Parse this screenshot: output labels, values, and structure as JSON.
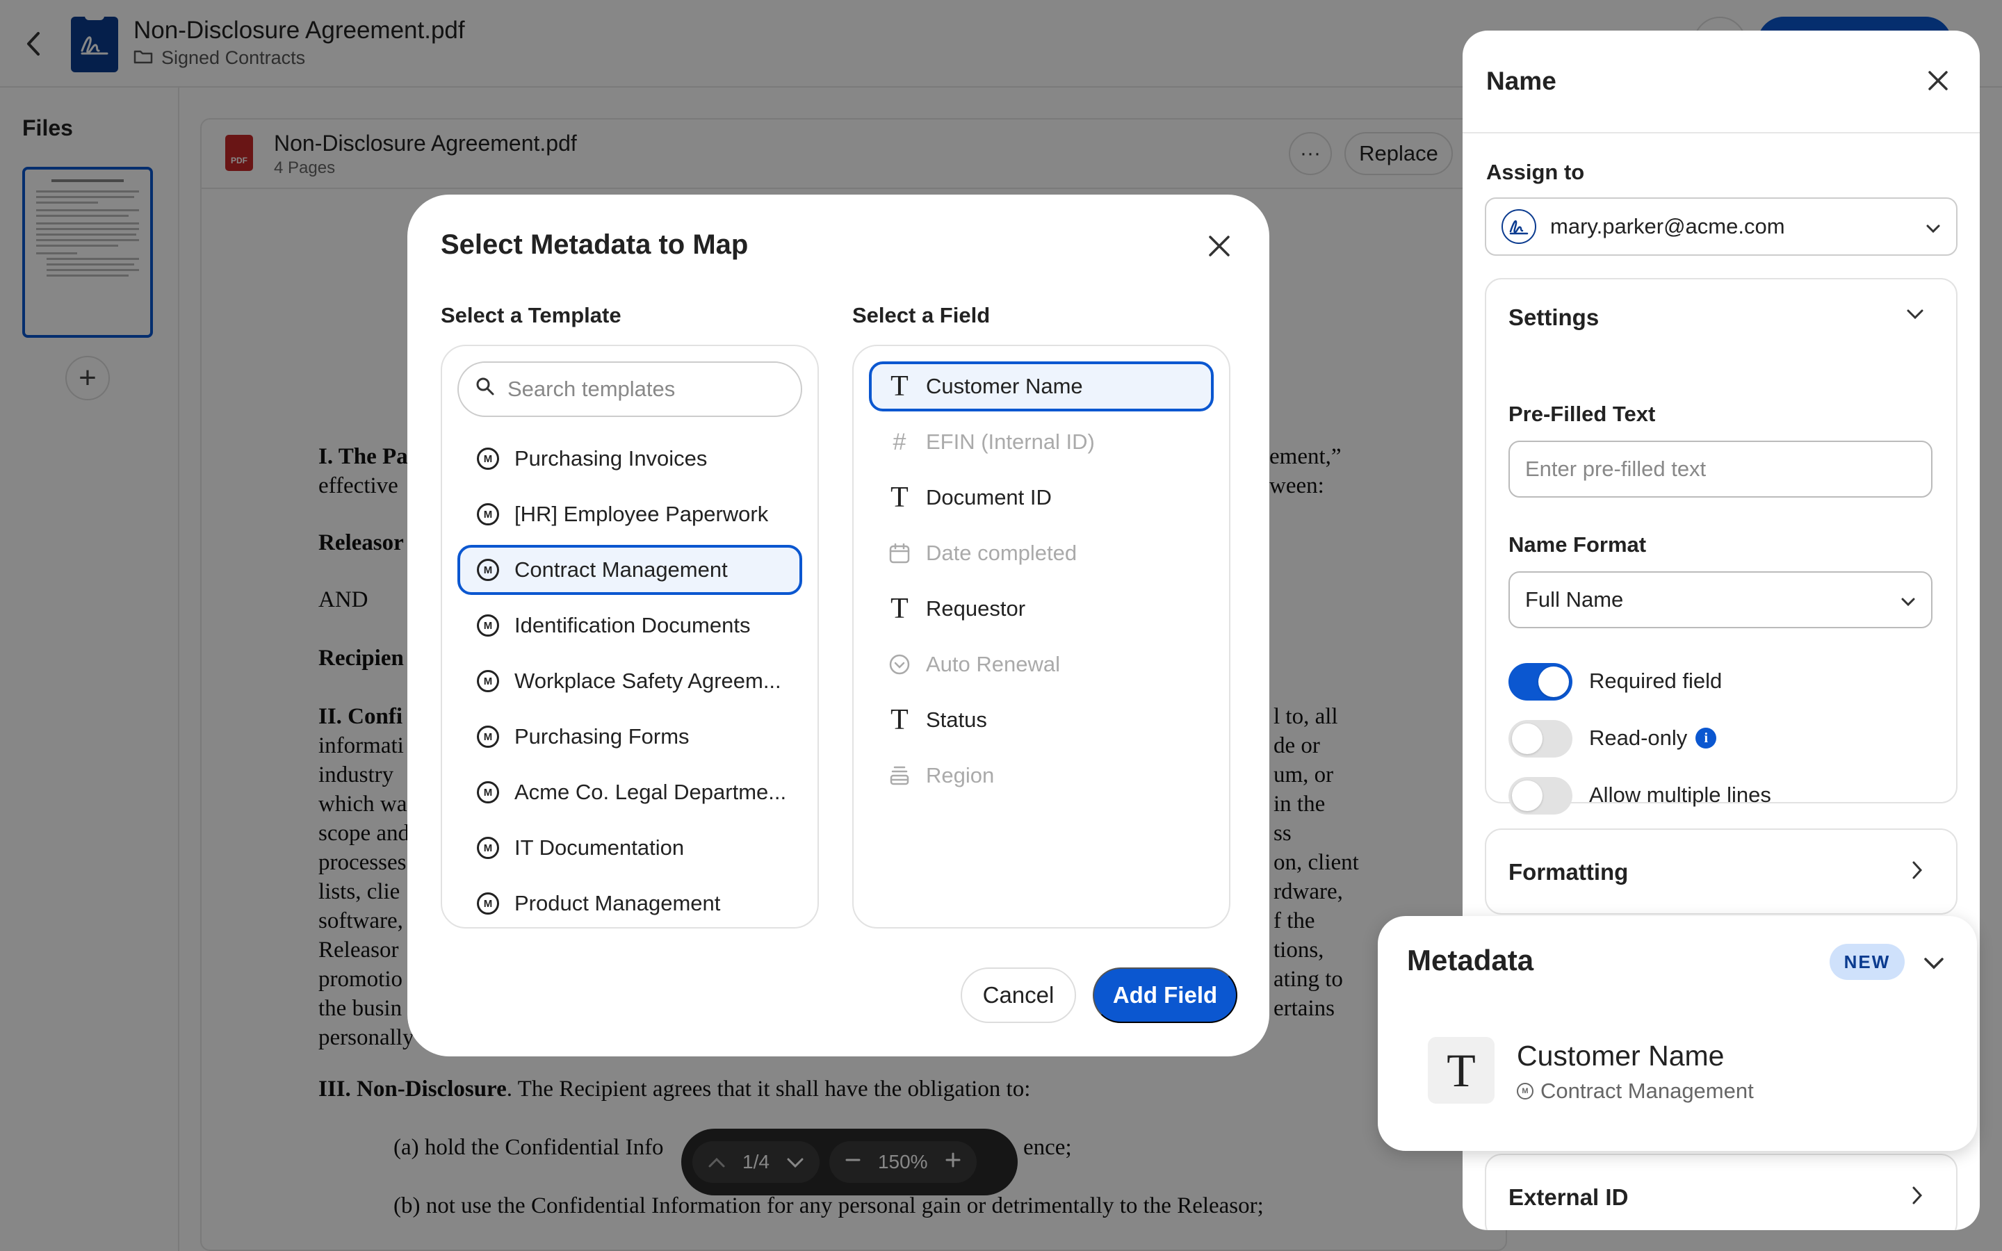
{
  "header": {
    "title": "Non-Disclosure Agreement.pdf",
    "folder": "Signed Contracts"
  },
  "files": {
    "label": "Files"
  },
  "viewer": {
    "file_name": "Non-Disclosure Agreement.pdf",
    "pages": "4 Pages",
    "replace_label": "Replace",
    "more_label": "···"
  },
  "document": {
    "line1a": "I. The Pa",
    "line1b": "ement,”",
    "line2a": "effective",
    "line2b": "ween:",
    "line3": "Releasor",
    "line4": "AND",
    "line5": "Recipien",
    "sec2_left": [
      "II. Confi",
      "informati",
      "industry",
      "which wa",
      "scope and",
      "processes",
      "lists, clie",
      "software,",
      "Releasor",
      "promotio",
      "the busin",
      "personally"
    ],
    "sec2_right": [
      "l to, all",
      "de or",
      "um, or",
      "in the",
      "ss",
      "on, client",
      "rdware,",
      "f the",
      "tions,",
      "ating to",
      "ertains",
      ""
    ],
    "sec3_title": "III. Non-Disclosure",
    "sec3_rest": ". The Recipient agrees that it shall have the obligation to:",
    "item_a_left": "(a) hold the Confidential Info",
    "item_a_right": "ence;",
    "item_b": "(b) not use the Confidential Information for any personal gain or detrimentally to the Releasor;"
  },
  "page_nav": {
    "page": "1/4",
    "zoom": "150%"
  },
  "modal": {
    "title": "Select Metadata to Map",
    "template_label": "Select a Template",
    "field_label": "Select a Field",
    "search_placeholder": "Search templates",
    "templates": [
      {
        "label": "Purchasing Invoices",
        "selected": false
      },
      {
        "label": "[HR] Employee Paperwork",
        "selected": false
      },
      {
        "label": "Contract Management",
        "selected": true
      },
      {
        "label": "Identification Documents",
        "selected": false
      },
      {
        "label": "Workplace Safety Agreem...",
        "selected": false
      },
      {
        "label": "Purchasing Forms",
        "selected": false
      },
      {
        "label": "Acme Co. Legal Departme...",
        "selected": false
      },
      {
        "label": "IT Documentation",
        "selected": false
      },
      {
        "label": "Product Management",
        "selected": false
      }
    ],
    "fields": [
      {
        "label": "Customer Name",
        "icon": "text-icon",
        "enabled": true,
        "selected": true
      },
      {
        "label": "EFIN (Internal ID)",
        "icon": "hash-icon",
        "enabled": false,
        "selected": false
      },
      {
        "label": "Document ID",
        "icon": "text-icon",
        "enabled": true,
        "selected": false
      },
      {
        "label": "Date completed",
        "icon": "calendar-icon",
        "enabled": false,
        "selected": false
      },
      {
        "label": "Requestor",
        "icon": "text-icon",
        "enabled": true,
        "selected": false
      },
      {
        "label": "Auto Renewal",
        "icon": "check-circle-icon",
        "enabled": false,
        "selected": false
      },
      {
        "label": "Status",
        "icon": "text-icon",
        "enabled": true,
        "selected": false
      },
      {
        "label": "Region",
        "icon": "list-icon",
        "enabled": false,
        "selected": false
      }
    ],
    "cancel_label": "Cancel",
    "add_label": "Add Field"
  },
  "side_panel": {
    "title": "Name",
    "assign_label": "Assign to",
    "assignee": "mary.parker@acme.com",
    "settings_label": "Settings",
    "prefilled_label": "Pre-Filled Text",
    "prefilled_placeholder": "Enter pre-filled text",
    "name_format_label": "Name Format",
    "name_format_value": "Full Name",
    "required_label": "Required field",
    "required_on": true,
    "readonly_label": "Read-only",
    "readonly_on": false,
    "multiline_label": "Allow multiple lines",
    "multiline_on": false,
    "formatting_label": "Formatting",
    "external_id_label": "External ID"
  },
  "metadata_card": {
    "title": "Metadata",
    "badge": "NEW",
    "field_name": "Customer Name",
    "template_name": "Contract Management"
  },
  "colors": {
    "accent": "#0b57d0",
    "selected_bg": "#eef4fd",
    "badge_bg": "#cfe1fb"
  }
}
